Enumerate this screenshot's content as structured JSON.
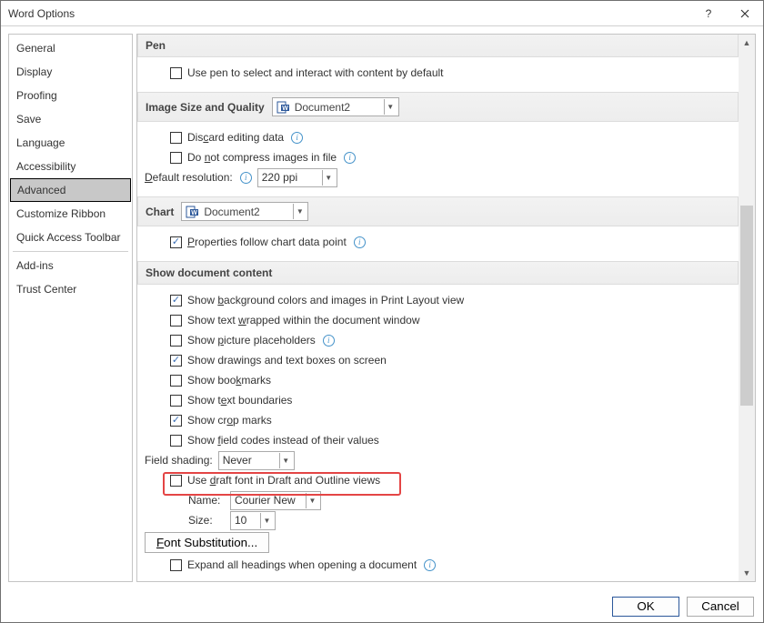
{
  "title": "Word Options",
  "sidebar": {
    "items": [
      "General",
      "Display",
      "Proofing",
      "Save",
      "Language",
      "Accessibility",
      "Advanced",
      "Customize Ribbon",
      "Quick Access Toolbar",
      "Add-ins",
      "Trust Center"
    ],
    "selected": "Advanced"
  },
  "sections": {
    "pen": {
      "title": "Pen",
      "usePen": {
        "label": "Use pen to select and interact with content by default",
        "checked": false
      }
    },
    "image": {
      "title": "Image Size and Quality",
      "doc": "Document2",
      "discard": {
        "label_pre": "Dis",
        "label_ul": "c",
        "label_post": "ard editing data",
        "checked": false
      },
      "noCompress": {
        "label_pre": "Do ",
        "label_ul": "n",
        "label_post": "ot compress images in file",
        "checked": false
      },
      "resolution": {
        "label_ul": "D",
        "label_post": "efault resolution:",
        "value": "220 ppi"
      }
    },
    "chart": {
      "title": "Chart",
      "doc": "Document2",
      "follow": {
        "label_ul": "P",
        "label_post": "roperties follow chart data point",
        "checked": true
      }
    },
    "showContent": {
      "title": "Show document content",
      "bg": {
        "pre": "Show ",
        "ul": "b",
        "post": "ackground colors and images in Print Layout view",
        "checked": true
      },
      "wrap": {
        "pre": "Show text ",
        "ul": "w",
        "post": "rapped within the document window",
        "checked": false
      },
      "pic": {
        "pre": "Show ",
        "ul": "p",
        "post": "icture placeholders",
        "checked": false
      },
      "draw": {
        "pre": "Show drawin",
        "ul": "g",
        "post": "s and text boxes on screen",
        "checked": true
      },
      "book": {
        "pre": "Show boo",
        "ul": "k",
        "post": "marks",
        "checked": false
      },
      "bound": {
        "pre": "Show t",
        "ul": "e",
        "post": "xt boundaries",
        "checked": false
      },
      "crop": {
        "pre": "Show cr",
        "ul": "o",
        "post": "p marks",
        "checked": true
      },
      "field": {
        "pre": "Show ",
        "ul": "f",
        "post": "ield codes instead of their values",
        "checked": false
      },
      "shading": {
        "label": "Field shading:",
        "value": "Never"
      },
      "draft": {
        "pre": "Use ",
        "ul": "d",
        "post": "raft font in Draft and Outline views",
        "checked": false
      },
      "name": {
        "label": "Name:",
        "value": "Courier New"
      },
      "size": {
        "label": "Size:",
        "value": "10"
      },
      "fontSub": {
        "pre": "",
        "ul": "F",
        "post": "ont Substitution..."
      },
      "expand": {
        "label": "Expand all headings when opening a document",
        "checked": false
      }
    }
  },
  "footer": {
    "ok": "OK",
    "cancel": "Cancel"
  }
}
